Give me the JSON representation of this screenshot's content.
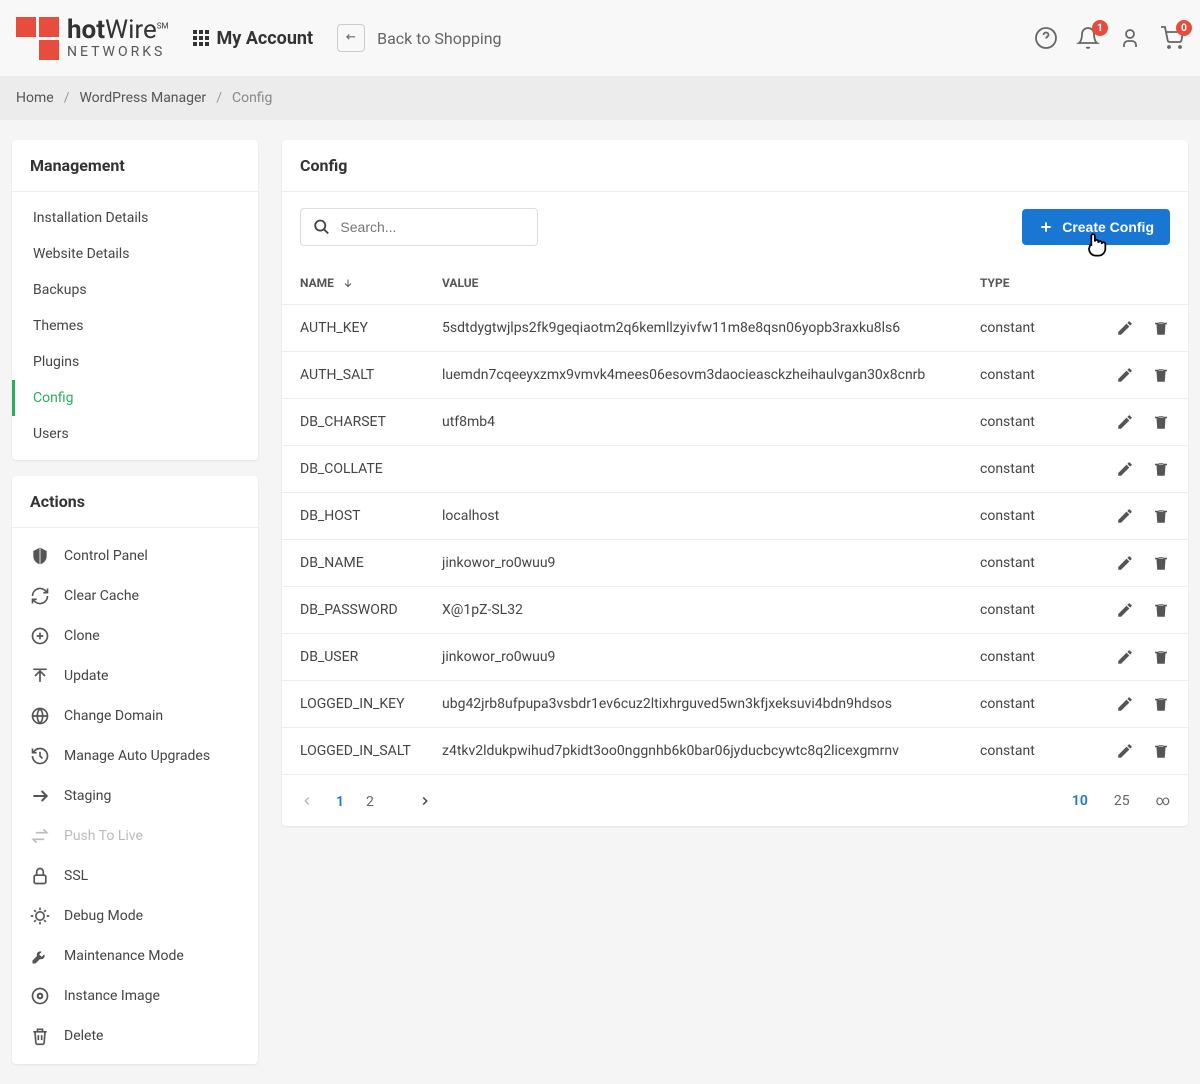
{
  "header": {
    "logo_main_1": "hot",
    "logo_main_2": "Wire",
    "logo_sm": "SM",
    "logo_sub": "NETWORKS",
    "account": "My Account",
    "back": "Back to Shopping",
    "notif_count": "1",
    "cart_count": "0"
  },
  "breadcrumb": {
    "home": "Home",
    "mgr": "WordPress Manager",
    "current": "Config"
  },
  "sidebar": {
    "mgmt_title": "Management",
    "mgmt_items": [
      "Installation Details",
      "Website Details",
      "Backups",
      "Themes",
      "Plugins",
      "Config",
      "Users"
    ],
    "actions_title": "Actions",
    "actions": [
      {
        "label": "Control Panel",
        "icon": "shield"
      },
      {
        "label": "Clear Cache",
        "icon": "refresh"
      },
      {
        "label": "Clone",
        "icon": "plus-circle"
      },
      {
        "label": "Update",
        "icon": "upload"
      },
      {
        "label": "Change Domain",
        "icon": "globe"
      },
      {
        "label": "Manage Auto Upgrades",
        "icon": "history"
      },
      {
        "label": "Staging",
        "icon": "arrow-right"
      },
      {
        "label": "Push To Live",
        "icon": "swap",
        "disabled": true
      },
      {
        "label": "SSL",
        "icon": "lock"
      },
      {
        "label": "Debug Mode",
        "icon": "bug"
      },
      {
        "label": "Maintenance Mode",
        "icon": "wrench"
      },
      {
        "label": "Instance Image",
        "icon": "target"
      },
      {
        "label": "Delete",
        "icon": "trash"
      }
    ]
  },
  "main": {
    "title": "Config",
    "search_placeholder": "Search...",
    "create_label": "Create Config",
    "col_name": "NAME",
    "col_value": "VALUE",
    "col_type": "TYPE",
    "rows": [
      {
        "name": "AUTH_KEY",
        "value": "5sdtdygtwjlps2fk9geqiaotm2q6kemllzyivfw11m8e8qsn06yopb3raxku8ls6",
        "type": "constant"
      },
      {
        "name": "AUTH_SALT",
        "value": "luemdn7cqeeyxzmx9vmvk4mees06esovm3daocieasckzheihaulvgan30x8cnrb",
        "type": "constant"
      },
      {
        "name": "DB_CHARSET",
        "value": "utf8mb4",
        "type": "constant"
      },
      {
        "name": "DB_COLLATE",
        "value": "",
        "type": "constant"
      },
      {
        "name": "DB_HOST",
        "value": "localhost",
        "type": "constant"
      },
      {
        "name": "DB_NAME",
        "value": "jinkowor_ro0wuu9",
        "type": "constant"
      },
      {
        "name": "DB_PASSWORD",
        "value": "X@1pZ-SL32",
        "type": "constant"
      },
      {
        "name": "DB_USER",
        "value": "jinkowor_ro0wuu9",
        "type": "constant"
      },
      {
        "name": "LOGGED_IN_KEY",
        "value": "ubg42jrb8ufpupa3vsbdr1ev6cuz2ltixhrguved5wn3kfjxeksuvi4bdn9hdsos",
        "type": "constant"
      },
      {
        "name": "LOGGED_IN_SALT",
        "value": "z4tkv2ldukpwihud7pkidt3oo0nggnhb6k0bar06jyducbcywtc8q2licexgmrnv",
        "type": "constant"
      }
    ],
    "pages": [
      "1",
      "2"
    ],
    "page_sizes": [
      "10",
      "25",
      "∞"
    ]
  }
}
